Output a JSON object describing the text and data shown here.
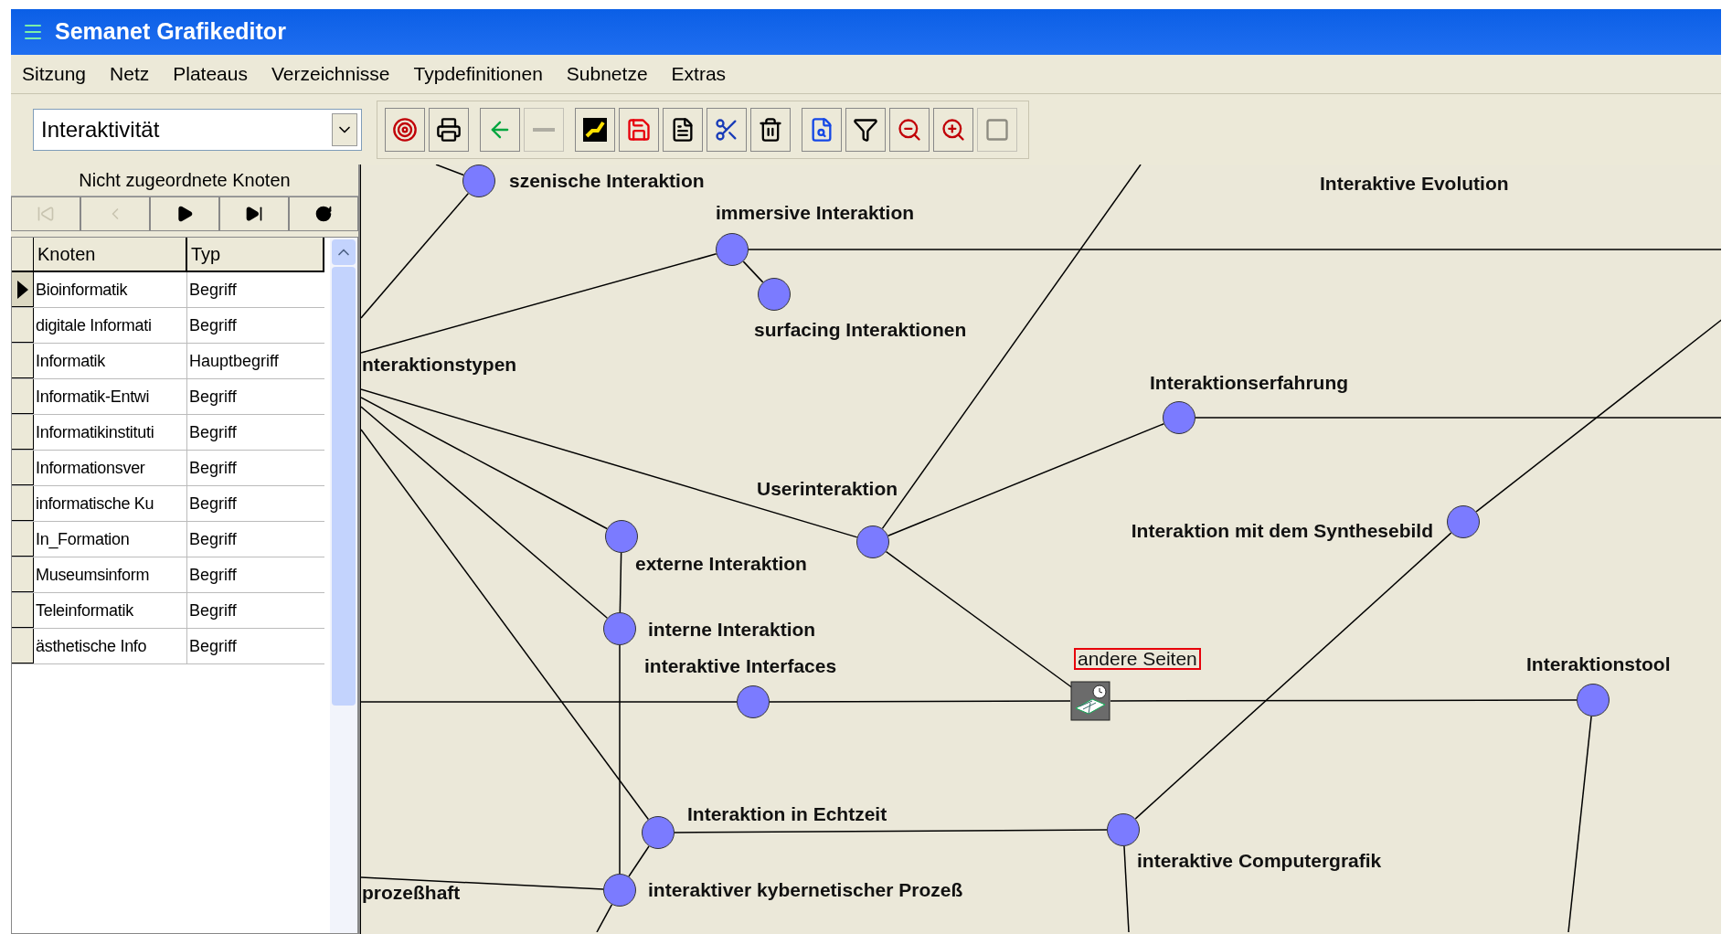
{
  "window": {
    "title": "Semanet Grafikeditor"
  },
  "menu": [
    "Sitzung",
    "Netz",
    "Plateaus",
    "Verzeichnisse",
    "Typdefinitionen",
    "Subnetze",
    "Extras"
  ],
  "toolbar": {
    "combobox": {
      "value": "Interaktivität"
    },
    "buttons": [
      {
        "disabled": false
      },
      {
        "disabled": false
      },
      {
        "disabled": false
      },
      {
        "disabled": true
      },
      {
        "disabled": false
      },
      {
        "disabled": false
      },
      {
        "disabled": false
      },
      {
        "disabled": false
      },
      {
        "disabled": false
      },
      {
        "disabled": false
      },
      {
        "disabled": false
      },
      {
        "disabled": false
      },
      {
        "disabled": false
      },
      {
        "disabled": true
      }
    ]
  },
  "sidebar": {
    "title": "Nicht zugeordnete Knoten",
    "nav_buttons": [
      {
        "disabled": true
      },
      {
        "disabled": true
      },
      {
        "disabled": false
      },
      {
        "disabled": false
      },
      {
        "disabled": false
      }
    ],
    "table": {
      "columns": [
        "Knoten",
        "Typ"
      ],
      "rows": [
        {
          "knoten": "Bioinformatik",
          "typ": "Begriff",
          "selected": true
        },
        {
          "knoten": "digitale Informati",
          "typ": "Begriff",
          "selected": false
        },
        {
          "knoten": "Informatik",
          "typ": "Hauptbegriff",
          "selected": false
        },
        {
          "knoten": "Informatik-Entwi",
          "typ": "Begriff",
          "selected": false
        },
        {
          "knoten": "Informatikinstituti",
          "typ": "Begriff",
          "selected": false
        },
        {
          "knoten": "Informationsver",
          "typ": "Begriff",
          "selected": false
        },
        {
          "knoten": "informatische Ku",
          "typ": "Begriff",
          "selected": false
        },
        {
          "knoten": "In_Formation",
          "typ": "Begriff",
          "selected": false
        },
        {
          "knoten": "Museumsinform",
          "typ": "Begriff",
          "selected": false
        },
        {
          "knoten": "Teleinformatik",
          "typ": "Begriff",
          "selected": false
        },
        {
          "knoten": "ästhetische Info",
          "typ": "Begriff",
          "selected": false
        }
      ]
    }
  },
  "graph": {
    "nodes": [
      {
        "label": "nteraktionstypen",
        "kind": "label"
      },
      {
        "label": "szenische Interaktion",
        "kind": "concept"
      },
      {
        "label": "Interaktive Evolution",
        "kind": "label"
      },
      {
        "label": "immersive Interaktion",
        "kind": "concept"
      },
      {
        "label": "surfacing Interaktionen",
        "kind": "concept"
      },
      {
        "label": "Interaktionserfahrung",
        "kind": "concept"
      },
      {
        "label": "Userinteraktion",
        "kind": "concept"
      },
      {
        "label": "Interaktion mit dem Synthesebild",
        "kind": "concept"
      },
      {
        "label": "externe Interaktion",
        "kind": "concept"
      },
      {
        "label": "interne Interaktion",
        "kind": "concept"
      },
      {
        "label": "interaktive Interfaces",
        "kind": "concept"
      },
      {
        "label": "andere Seiten",
        "kind": "document"
      },
      {
        "label": "Interaktionstool",
        "kind": "concept"
      },
      {
        "label": "Interaktion in Echtzeit",
        "kind": "concept"
      },
      {
        "label": "interaktive Computergrafik",
        "kind": "concept"
      },
      {
        "label": "prozeßhaft",
        "kind": "label"
      },
      {
        "label": "interaktiver kybernetischer Prozeß",
        "kind": "concept"
      }
    ]
  }
}
